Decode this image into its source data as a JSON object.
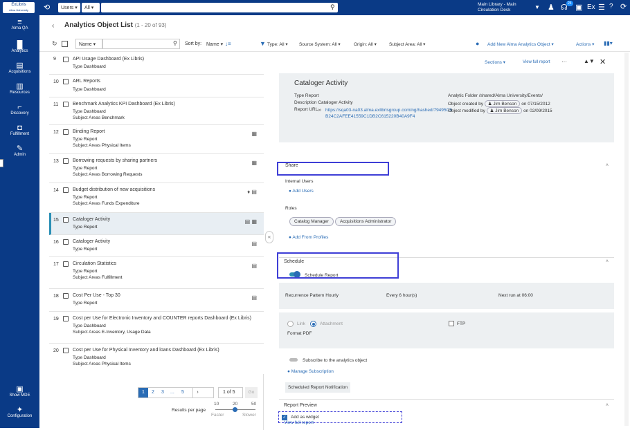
{
  "topbar": {
    "logo_line1": "ExLibris",
    "logo_line2": "Alma University",
    "search_scope": "Users",
    "search_filter": "All",
    "library": "Main Library - Main",
    "desk": "Circulation Desk",
    "task_badge": "24",
    "user_initials": "Ex"
  },
  "nav": [
    {
      "label": "Alma QA",
      "icon": "list-icon"
    },
    {
      "label": "Analytics",
      "icon": "chart-icon"
    },
    {
      "label": "Acquisitions",
      "icon": "cart-icon"
    },
    {
      "label": "Resources",
      "icon": "books-icon"
    },
    {
      "label": "Discovery",
      "icon": "telescope-icon"
    },
    {
      "label": "Fulfillment",
      "icon": "box-icon"
    },
    {
      "label": "Admin",
      "icon": "wrench-icon"
    },
    {
      "label": "Show MDE",
      "icon": "mde-icon"
    },
    {
      "label": "Configuration",
      "icon": "gear-icon"
    }
  ],
  "header": {
    "title": "Analytics Object List",
    "count": "(1 - 20 of 93)"
  },
  "toolbar": {
    "search_field": "Name",
    "sort_label": "Sort by:",
    "sort_value": "Name",
    "type_filter": "Type: All",
    "source_filter": "Source System: All",
    "origin_filter": "Origin: All",
    "subject_filter": "Subject Area: All",
    "add_new": "Add New Alma Analytics Object",
    "actions": "Actions"
  },
  "list": [
    {
      "num": "9",
      "title": "API Usage Dashboard (Ex Libris)",
      "lines": [
        [
          "Type",
          "Dashboard"
        ]
      ],
      "icons": ""
    },
    {
      "num": "10",
      "title": "ARL Reports",
      "lines": [
        [
          "Type",
          "Dashboard"
        ]
      ],
      "icons": ""
    },
    {
      "num": "11",
      "title": "Benchmark Analytics KPI Dashboard (Ex Libris)",
      "lines": [
        [
          "Type",
          "Dashboard"
        ],
        [
          "Subject Areas",
          "Benchmark"
        ]
      ],
      "icons": ""
    },
    {
      "num": "12",
      "title": "Binding Report",
      "lines": [
        [
          "Type",
          "Report"
        ],
        [
          "Subject Areas",
          "Physical Items"
        ]
      ],
      "icons": "▦"
    },
    {
      "num": "13",
      "title": "Borrowing requests by sharing partners",
      "lines": [
        [
          "Type",
          "Report"
        ],
        [
          "Subject Areas",
          "Borrowing Requests"
        ]
      ],
      "icons": "▦"
    },
    {
      "num": "14",
      "title": "Budget distribution of new acquisitions",
      "lines": [
        [
          "Type",
          "Report"
        ],
        [
          "Subject Areas",
          "Funds Expenditure"
        ]
      ],
      "icons": "♦ ▤"
    },
    {
      "num": "15",
      "title": "Cataloger Activity",
      "lines": [
        [
          "Type",
          "Report"
        ]
      ],
      "icons": "▤ ▦"
    },
    {
      "num": "16",
      "title": "Cataloger Activity",
      "lines": [
        [
          "Type",
          "Report"
        ]
      ],
      "icons": "▤"
    },
    {
      "num": "17",
      "title": "Circulation Statistics",
      "lines": [
        [
          "Type",
          "Report"
        ],
        [
          "Subject Areas",
          "Fulfillment"
        ]
      ],
      "icons": "▤"
    },
    {
      "num": "18",
      "title": "Cost Per Use - Top 30",
      "lines": [
        [
          "Type",
          "Report"
        ]
      ],
      "icons": "▤"
    },
    {
      "num": "19",
      "title": "Cost per Use for Electronic Inventory and COUNTER reports Dashboard (Ex Libris)",
      "lines": [
        [
          "Type",
          "Dashboard"
        ],
        [
          "Subject Areas",
          "E-Inventory, Usage Data"
        ]
      ],
      "icons": ""
    },
    {
      "num": "20",
      "title": "Cost per Use for Physical Inventory and loans Dashboard (Ex Libris)",
      "lines": [
        [
          "Type",
          "Dashboard"
        ],
        [
          "Subject Areas",
          "Physical Items"
        ]
      ],
      "icons": ""
    }
  ],
  "pagination": {
    "pages": [
      "1",
      "2",
      "3",
      "...",
      "5"
    ],
    "page_of": "1 of 5",
    "go": "Go",
    "rpp_label": "Results per page",
    "rpp": [
      "10",
      "20",
      "50"
    ],
    "faster": "Faster",
    "slower": "Slower"
  },
  "detail": {
    "sections_btn": "Sections",
    "view_full": "View full report",
    "title": "Cataloger Activity",
    "type_label": "Type",
    "type": "Report",
    "desc_label": "Description",
    "desc": "Cataloger Activity",
    "url_label": "Report URL",
    "url": "https://sqa03-na03.alma.exlibrisgroup.com/ng/hashed/79495C6B24C2AFEE41559C1DB2C615220B40A9F4",
    "folder_label": "Analytic Folder",
    "folder": "/shared/Alma University/Events/",
    "created_label": "Object created by",
    "created_by": "Jim Benson",
    "created_on_label": "on",
    "created_on": "07/15/2012",
    "modified_label": "Object modified by",
    "modified_by": "Jim Benson",
    "modified_on_label": "on",
    "modified_on": "02/09/2015",
    "share": "Share",
    "internal_users": "Internal Users",
    "add_users": "Add Users",
    "roles": "Roles",
    "role_chips": [
      "Catalog Manager",
      "Acquisitions Administrator"
    ],
    "add_profiles": "Add From Profiles",
    "schedule": "Schedule",
    "schedule_report": "Schedule Report",
    "recurrence_label": "Recurrence Pattern",
    "recurrence": "Hourly",
    "every": "Every 6 hour(s)",
    "next_run": "Next run at 06:00",
    "link": "Link",
    "attachment": "Attachment",
    "ftp": "FTP",
    "format_label": "Format",
    "format": "PDF",
    "subscribe": "Subscribe to the analytics object",
    "manage_sub": "Manage Subscription",
    "sched_notif": "Scheduled Report Notification",
    "preview": "Report Preview",
    "view_full_link": "View full report",
    "add_widget": "Add as widget"
  }
}
